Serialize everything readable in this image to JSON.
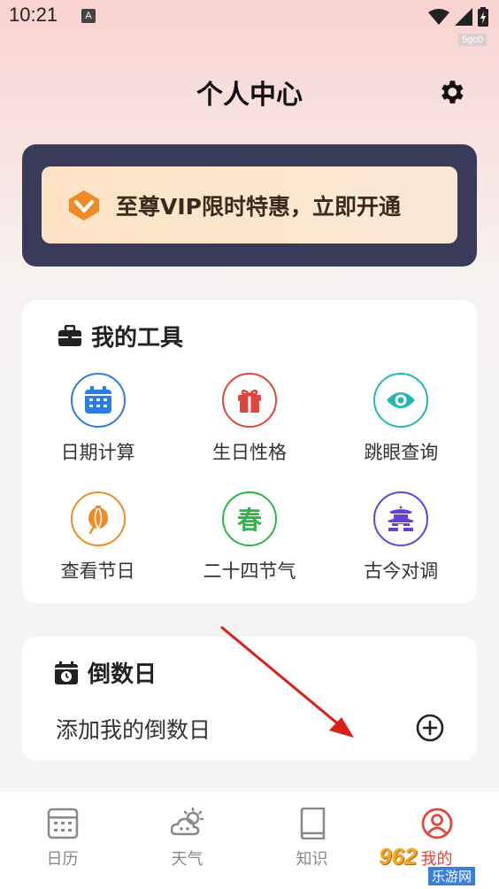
{
  "status_bar": {
    "time": "10:21",
    "notif_icon": "A",
    "tag": "5gc0"
  },
  "header": {
    "title": "个人中心",
    "settings_icon": "gear-icon"
  },
  "vip": {
    "text": "至尊VIP限时特惠，立即开通",
    "icon": "vip-diamond-icon"
  },
  "tools": {
    "title": "我的工具",
    "icon": "briefcase-icon",
    "items": [
      {
        "label": "日期计算",
        "icon": "calendar-icon",
        "color": "#2a7de1"
      },
      {
        "label": "生日性格",
        "icon": "gift-icon",
        "color": "#e0443c"
      },
      {
        "label": "跳眼查询",
        "icon": "eye-icon",
        "color": "#23b8b0"
      },
      {
        "label": "查看节日",
        "icon": "lantern-icon",
        "color": "#f08a24"
      },
      {
        "label": "二十四节气",
        "icon": "spring-char-icon",
        "glyph": "春",
        "color": "#2fb548"
      },
      {
        "label": "古今对调",
        "icon": "pagoda-icon",
        "color": "#6a3fd8"
      }
    ]
  },
  "countdown": {
    "title": "倒数日",
    "icon": "calendar-clock-icon",
    "add_label": "添加我的倒数日",
    "add_icon": "plus-circle-icon"
  },
  "nav": {
    "items": [
      {
        "label": "日历",
        "icon": "calendar-grid-icon",
        "active": false
      },
      {
        "label": "天气",
        "icon": "weather-icon",
        "active": false
      },
      {
        "label": "知识",
        "icon": "book-icon",
        "active": false
      },
      {
        "label": "我的",
        "icon": "user-icon",
        "active": true
      }
    ]
  },
  "watermark": {
    "main": "962",
    "sub": "乐游网"
  },
  "colors": {
    "accent": "#e0473d",
    "vip_bg": "#3a3a5a"
  }
}
